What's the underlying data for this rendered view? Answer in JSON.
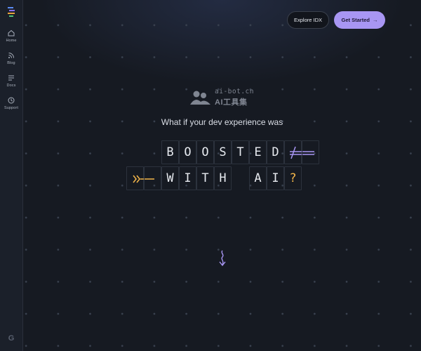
{
  "sidebar": {
    "items": [
      {
        "label": "Home",
        "icon": "home-icon"
      },
      {
        "label": "Blog",
        "icon": "rss-icon"
      },
      {
        "label": "Docs",
        "icon": "docs-icon"
      },
      {
        "label": "Support",
        "icon": "support-icon"
      }
    ],
    "footer_icon": "google-icon",
    "footer_glyph": "G"
  },
  "header": {
    "explore_label": "Explore IDX",
    "get_started_label": "Get Started",
    "get_started_arrow": "→"
  },
  "watermark": {
    "line1": "ai-bot.cn",
    "line2": "AI工具集"
  },
  "hero": {
    "headline": "What if your dev experience was",
    "row1": [
      "B",
      "O",
      "O",
      "S",
      "T",
      "E",
      "D"
    ],
    "row2": [
      "W",
      "I",
      "T",
      "H",
      "",
      "A",
      "I",
      "?"
    ]
  },
  "colors": {
    "background": "#161a22",
    "sidebar": "#1b202a",
    "accent_purple": "#a896f3",
    "accent_orange": "#f3b64a",
    "tile_border": "#2c323d"
  }
}
